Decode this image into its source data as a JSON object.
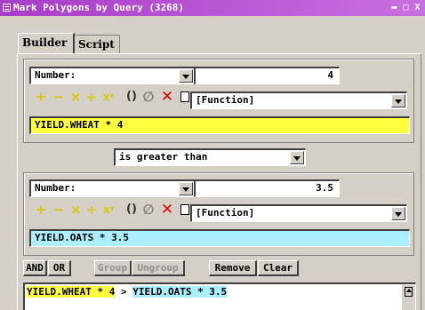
{
  "window": {
    "title": "Mark Polygons by Query (3268)",
    "controls": {
      "minimize": "▬",
      "maximize": "□",
      "close": "X"
    }
  },
  "tabs": [
    {
      "label": "Builder",
      "active": true
    },
    {
      "label": "Script",
      "active": false
    }
  ],
  "operand1": {
    "type_label": "Number:",
    "value": "4",
    "function_label": "[Function]",
    "expression": {
      "field": "YIELD.WHEAT",
      "operator": "*",
      "value": "4"
    }
  },
  "comparison": {
    "label": "is greater than"
  },
  "operand2": {
    "type_label": "Number:",
    "value": "3.5",
    "function_label": "[Function]",
    "expression": {
      "field": "YIELD.OATS",
      "operator": "*",
      "value": "3.5"
    }
  },
  "toolbar": {
    "plus": "+",
    "minus": "−",
    "multiply": "×",
    "divide": "÷",
    "power": "xʸ",
    "paren": "()",
    "no_function": "∅",
    "clear": "✕"
  },
  "bottom_buttons": {
    "and": "AND",
    "or": "OR",
    "group": "Group",
    "ungroup": "Ungroup",
    "remove": "Remove",
    "clear": "Clear"
  },
  "query_text": {
    "left": "YIELD.WHEAT * 4",
    "operator": ">",
    "right": "YIELD.OATS * 3.5"
  },
  "colors": {
    "titlebar": "#b050d0",
    "highlight_yellow": "#ffff40",
    "highlight_cyan": "#aaeeff",
    "clear_red": "#e00000"
  }
}
